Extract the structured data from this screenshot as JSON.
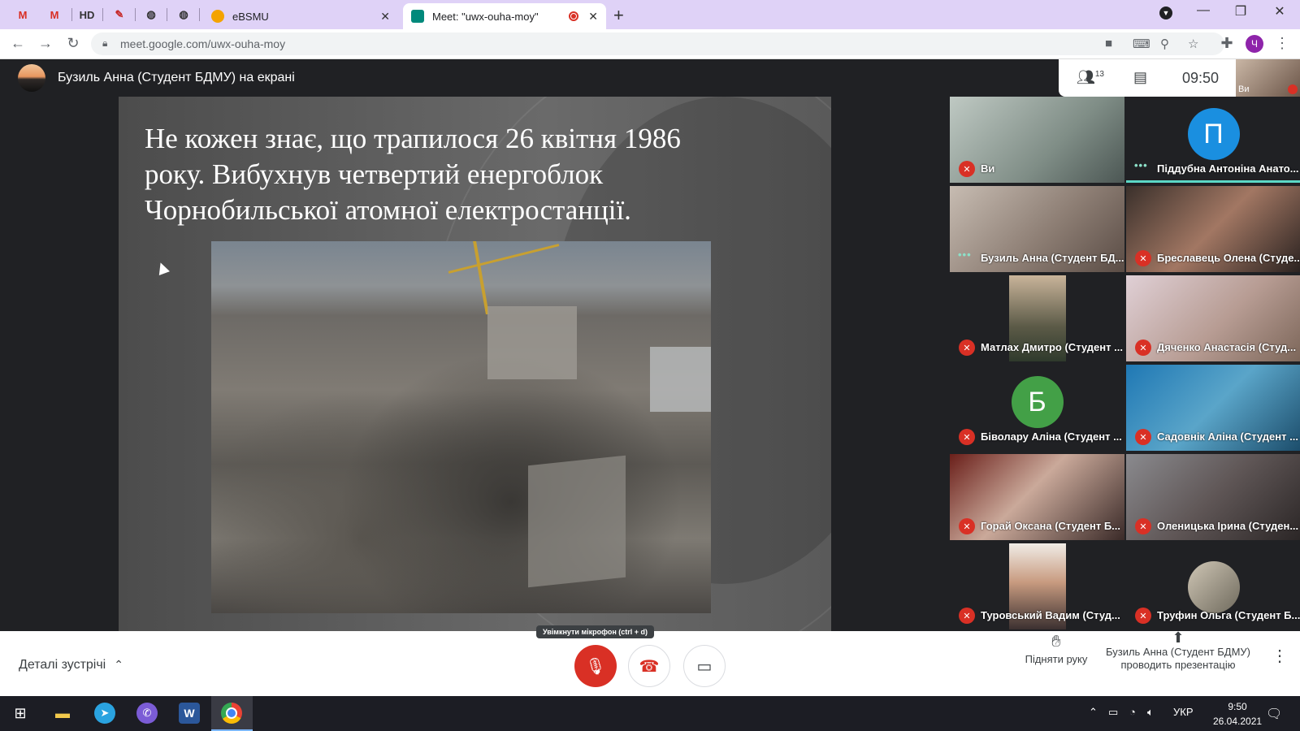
{
  "browser": {
    "pinned_tabs": [
      "M",
      "M",
      "HD",
      "",
      "",
      ""
    ],
    "tabs": [
      {
        "title": "eBSMU",
        "favicon_color": "#f4a300"
      },
      {
        "title": "Meet: \"uwx-ouha-moy\"",
        "favicon_color": "#00897b"
      }
    ],
    "url": "meet.google.com/uwx-ouha-moy",
    "profile_initial": "Ч"
  },
  "meet": {
    "presenter_title": "Бузиль Анна (Студент БДМУ) на екрані",
    "participant_count": "13",
    "time": "09:50",
    "self_label": "Ви"
  },
  "slide": {
    "text": "Не кожен знає, що трапилося 26 квітня 1986 року. Вибухнув четвертий енергоблок Чорнобильської атомної електростанції."
  },
  "participants": [
    {
      "name": "Ви",
      "muted": true
    },
    {
      "name": "Піддубна Антоніна Анато...",
      "initial": "П",
      "color": "#1a8fe0",
      "speaking": true
    },
    {
      "name": "Бузиль Анна (Студент БД...",
      "speaking": true
    },
    {
      "name": "Бреславець Олена (Студе...",
      "muted": true
    },
    {
      "name": "Матлах Дмитро (Студент ...",
      "muted": true
    },
    {
      "name": "Дяченко Анастасія (Студ...",
      "muted": true
    },
    {
      "name": "Біволару Аліна (Студент ...",
      "initial": "Б",
      "color": "#43a047",
      "muted": true
    },
    {
      "name": "Садовнік Аліна (Студент ...",
      "muted": true
    },
    {
      "name": "Горай Оксана (Студент Б...",
      "muted": true
    },
    {
      "name": "Оленицька Ірина (Студен...",
      "muted": true
    },
    {
      "name": "Туровський Вадим (Студ...",
      "muted": true
    },
    {
      "name": "Труфин Ольга (Студент Б...",
      "muted": true
    }
  ],
  "controls": {
    "details_label": "Деталі зустрічі",
    "mic_tooltip": "Увімкнути мікрофон (ctrl + d)",
    "raise_hand_label": "Підняти руку",
    "presenting_line1": "Бузиль Анна (Студент БДМУ)",
    "presenting_line2": "проводить презентацію"
  },
  "taskbar": {
    "language": "УКР",
    "time": "9:50",
    "date": "26.04.2021"
  }
}
